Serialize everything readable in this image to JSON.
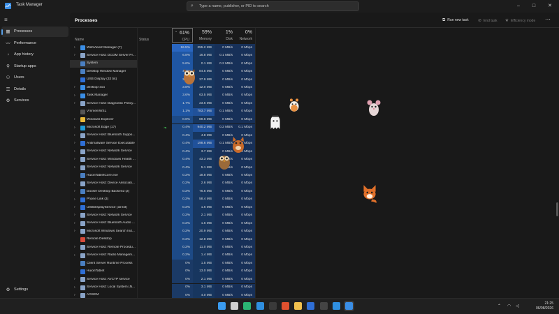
{
  "window": {
    "title": "Task Manager"
  },
  "search": {
    "placeholder": "Type a name, publisher, or PID to search"
  },
  "sidebar": {
    "items": [
      {
        "label": "Processes",
        "icon": "processes-icon",
        "glyph": "▦",
        "active": true
      },
      {
        "label": "Performance",
        "icon": "performance-icon",
        "glyph": "〰",
        "active": false
      },
      {
        "label": "App history",
        "icon": "app-history-icon",
        "glyph": "◔",
        "active": false
      },
      {
        "label": "Startup apps",
        "icon": "startup-icon",
        "glyph": "⚲",
        "active": false
      },
      {
        "label": "Users",
        "icon": "users-icon",
        "glyph": "⚇",
        "active": false
      },
      {
        "label": "Details",
        "icon": "details-icon",
        "glyph": "☰",
        "active": false
      },
      {
        "label": "Services",
        "icon": "services-icon",
        "glyph": "⚙",
        "active": false
      }
    ],
    "settings_label": "Settings"
  },
  "toolbar": {
    "title": "Processes",
    "run_new_task": "Run new task",
    "end_task": "End task",
    "efficiency_mode": "Efficiency mode"
  },
  "columns": {
    "name": "Name",
    "status": "Status",
    "cpu": {
      "pct": "61%",
      "label": "CPU"
    },
    "memory": {
      "pct": "59%",
      "label": "Memory"
    },
    "disk": {
      "pct": "1%",
      "label": "Disk"
    },
    "network": {
      "pct": "0%",
      "label": "Network"
    }
  },
  "processes": [
    {
      "expand": true,
      "name": "WebView2 Manager (7)",
      "cpu": "16.5%",
      "mem": "255.2 MB",
      "disk": "0 MB/s",
      "net": "0 Mbps",
      "icon": "#3a8ee6",
      "cpu_level": 3
    },
    {
      "expand": true,
      "name": "Service Host: DCOM Server Pr...",
      "cpu": "6.8%",
      "mem": "16.8 MB",
      "disk": "0.1 MB/s",
      "net": "0 Mbps",
      "icon": "#8aa4c8",
      "cpu_level": 2
    },
    {
      "expand": false,
      "name": "System",
      "cpu": "5.6%",
      "mem": "0.1 MB",
      "disk": "0.2 MB/s",
      "net": "0 Mbps",
      "icon": "#4a7fc1",
      "cpu_level": 2,
      "selected": true
    },
    {
      "expand": false,
      "name": "Desktop Window Manager",
      "cpu": "4.6%",
      "mem": "84.5 MB",
      "disk": "0 MB/s",
      "net": "0 Mbps",
      "icon": "#4a7fc1",
      "cpu_level": 2
    },
    {
      "expand": false,
      "name": "USB Display (32 bit)",
      "cpu": "3.6%",
      "mem": "37.9 MB",
      "disk": "0 MB/s",
      "net": "0 Mbps",
      "icon": "#2f6fd6",
      "cpu_level": 2
    },
    {
      "expand": true,
      "name": "desktop-zoo",
      "cpu": "3.8%",
      "mem": "12.0 MB",
      "disk": "0 MB/s",
      "net": "0 Mbps",
      "icon": "#3a8ee6",
      "cpu_level": 2
    },
    {
      "expand": true,
      "name": "Task Manager",
      "cpu": "3.6%",
      "mem": "63.5 MB",
      "disk": "0 MB/s",
      "net": "0 Mbps",
      "icon": "#3a8ee6",
      "cpu_level": 2
    },
    {
      "expand": true,
      "name": "Service Host: Diagnostic Policy...",
      "cpu": "1.7%",
      "mem": "23.6 MB",
      "disk": "0 MB/s",
      "net": "0 Mbps",
      "icon": "#8aa4c8",
      "cpu_level": 2
    },
    {
      "expand": false,
      "name": "VmmemWSL",
      "cpu": "1.1%",
      "mem": "783.7 MB",
      "disk": "0.1 MB/s",
      "net": "0 Mbps",
      "icon": "#555555",
      "cpu_level": 2,
      "mem_hi": true
    },
    {
      "expand": true,
      "name": "Windows Explorer",
      "cpu": "0.6%",
      "mem": "89.6 MB",
      "disk": "0 MB/s",
      "net": "0 Mbps",
      "icon": "#e8b93a",
      "cpu_level": 1
    },
    {
      "expand": true,
      "name": "Microsoft Edge (17)",
      "status_icon": true,
      "cpu": "0.4%",
      "mem": "940.2 MB",
      "disk": "0.2 MB/s",
      "net": "0.1 Mbps",
      "icon": "#1f9bd8",
      "cpu_level": 1,
      "mem_hi": true
    },
    {
      "expand": true,
      "name": "Service Host: Bluetooth Suppo...",
      "cpu": "0.4%",
      "mem": "4.8 MB",
      "disk": "0 MB/s",
      "net": "0 Mbps",
      "icon": "#8aa4c8",
      "cpu_level": 1
    },
    {
      "expand": true,
      "name": "Antimalware Service Executable",
      "cpu": "0.4%",
      "mem": "198.6 MB",
      "disk": "0.1 MB/s",
      "net": "0 Mbps",
      "icon": "#2f6fd6",
      "cpu_level": 1,
      "mem_hi": true
    },
    {
      "expand": true,
      "name": "Service Host: Network Service",
      "cpu": "0.4%",
      "mem": "3.7 MB",
      "disk": "0 MB/s",
      "net": "0 Mbps",
      "icon": "#8aa4c8",
      "cpu_level": 1
    },
    {
      "expand": true,
      "name": "Service Host: Windows Health ...",
      "cpu": "0.4%",
      "mem": "43.3 MB",
      "disk": "0 MB/s",
      "net": "0 Mbps",
      "icon": "#8aa4c8",
      "cpu_level": 1
    },
    {
      "expand": true,
      "name": "Service Host: Network Service",
      "cpu": "0.4%",
      "mem": "5.1 MB",
      "disk": "0 MB/s",
      "net": "0 Mbps",
      "icon": "#8aa4c8",
      "cpu_level": 1
    },
    {
      "expand": false,
      "name": "HuionTabletCore.exe",
      "cpu": "0.2%",
      "mem": "18.8 MB",
      "disk": "0 MB/s",
      "net": "0 Mbps",
      "icon": "#4a7fc1",
      "cpu_level": 1
    },
    {
      "expand": true,
      "name": "Service Host: Device Associati...",
      "cpu": "0.2%",
      "mem": "2.6 MB",
      "disk": "0 MB/s",
      "net": "0 Mbps",
      "icon": "#8aa4c8",
      "cpu_level": 1
    },
    {
      "expand": true,
      "name": "Docker Desktop Backend (2)",
      "cpu": "0.2%",
      "mem": "76.6 MB",
      "disk": "0 MB/s",
      "net": "0 Mbps",
      "icon": "#4a7fc1",
      "cpu_level": 1
    },
    {
      "expand": true,
      "name": "Phone Link (3)",
      "cpu": "0.2%",
      "mem": "58.4 MB",
      "disk": "0 MB/s",
      "net": "0 Mbps",
      "icon": "#2f6fd6",
      "cpu_level": 1
    },
    {
      "expand": true,
      "name": "USBDisplayService (32 bit)",
      "cpu": "0.2%",
      "mem": "1.6 MB",
      "disk": "0 MB/s",
      "net": "0 Mbps",
      "icon": "#2f6fd6",
      "cpu_level": 1
    },
    {
      "expand": true,
      "name": "Service Host: Network Service",
      "cpu": "0.2%",
      "mem": "2.1 MB",
      "disk": "0 MB/s",
      "net": "0 Mbps",
      "icon": "#8aa4c8",
      "cpu_level": 1
    },
    {
      "expand": true,
      "name": "Service Host: Bluetooth Audio ...",
      "cpu": "0.2%",
      "mem": "1.6 MB",
      "disk": "0 MB/s",
      "net": "0 Mbps",
      "icon": "#8aa4c8",
      "cpu_level": 1
    },
    {
      "expand": true,
      "name": "Microsoft Windows Search Ind...",
      "cpu": "0.2%",
      "mem": "20.9 MB",
      "disk": "0 MB/s",
      "net": "0 Mbps",
      "icon": "#8aa4c8",
      "cpu_level": 1
    },
    {
      "expand": false,
      "name": "Remote Desktop",
      "cpu": "0.2%",
      "mem": "12.8 MB",
      "disk": "0 MB/s",
      "net": "0 Mbps",
      "icon": "#d64a3a",
      "cpu_level": 1
    },
    {
      "expand": true,
      "name": "Service Host: Remote Procedu...",
      "cpu": "0.2%",
      "mem": "11.0 MB",
      "disk": "0 MB/s",
      "net": "0 Mbps",
      "icon": "#8aa4c8",
      "cpu_level": 1
    },
    {
      "expand": true,
      "name": "Service Host: Radio Managem...",
      "cpu": "0.2%",
      "mem": "1.4 MB",
      "disk": "0 MB/s",
      "net": "0 Mbps",
      "icon": "#8aa4c8",
      "cpu_level": 1
    },
    {
      "expand": false,
      "name": "Client Server Runtime Process",
      "cpu": "0%",
      "mem": "1.5 MB",
      "disk": "0 MB/s",
      "net": "0 Mbps",
      "icon": "#4a7fc1",
      "cpu_level": 0
    },
    {
      "expand": false,
      "name": "HuionTablet",
      "cpu": "0%",
      "mem": "13.0 MB",
      "disk": "0 MB/s",
      "net": "0 Mbps",
      "icon": "#2f6fd6",
      "cpu_level": 0
    },
    {
      "expand": true,
      "name": "Service Host: AVCTP service",
      "cpu": "0%",
      "mem": "2.1 MB",
      "disk": "0 MB/s",
      "net": "0 Mbps",
      "icon": "#8aa4c8",
      "cpu_level": 0
    },
    {
      "expand": true,
      "name": "Service Host: Local System (N...",
      "cpu": "0%",
      "mem": "3.1 MB",
      "disk": "0 MB/s",
      "net": "0 Mbps",
      "icon": "#8aa4c8",
      "cpu_level": 0
    },
    {
      "expand": true,
      "name": "AGSEM",
      "cpu": "0%",
      "mem": "4.0 MB",
      "disk": "0 MB/s",
      "net": "0 Mbps",
      "icon": "#8aa4c8",
      "cpu_level": 0
    }
  ],
  "colors": {
    "cpu_levels": [
      "#1b3a66",
      "#1d4a86",
      "#1f56a3",
      "#2a66c0"
    ],
    "mem_default": "#17365f",
    "mem_hi": "#20519a",
    "other_cols": "#173058"
  },
  "taskbar": {
    "apps": [
      {
        "name": "windows-start-icon",
        "color": "#3a9bf0"
      },
      {
        "name": "task-view-icon",
        "color": "#cfcfcf"
      },
      {
        "name": "edge-browser-icon",
        "color": "#2bb673"
      },
      {
        "name": "vscode-icon",
        "color": "#2f8fe0"
      },
      {
        "name": "terminal-icon",
        "color": "#3a3a3a"
      },
      {
        "name": "app-red-icon",
        "color": "#e0512f"
      },
      {
        "name": "file-explorer-icon",
        "color": "#f2c14e"
      },
      {
        "name": "app-blue-icon",
        "color": "#2f6fd6"
      },
      {
        "name": "app-dark-icon",
        "color": "#444444"
      },
      {
        "name": "mail-icon",
        "color": "#2f8fe0"
      },
      {
        "name": "task-manager-icon",
        "color": "#3a8ee6"
      }
    ],
    "time": "21:25",
    "date": "06/08/2026"
  }
}
